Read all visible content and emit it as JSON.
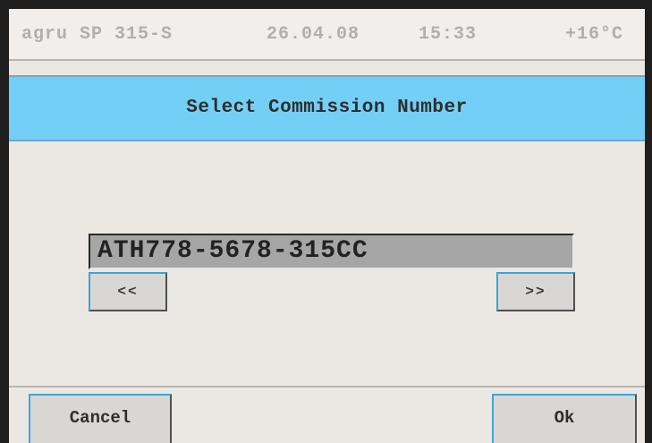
{
  "status_bar": {
    "device": "agru SP 315-S",
    "date": "26.04.08",
    "time": "15:33",
    "temperature": "+16°C"
  },
  "header": {
    "title": "Select Commission Number"
  },
  "commission": {
    "value": "ATH778-5678-315CC"
  },
  "navigation": {
    "prev_label": "<<",
    "next_label": ">>"
  },
  "actions": {
    "cancel_label": "Cancel",
    "ok_label": "Ok"
  },
  "colors": {
    "header_bg": "#73cff5",
    "screen_bg": "#ebe7e3",
    "field_bg": "#a6a6a6",
    "button_bg": "#d9d7d4",
    "button_highlight": "#3aa6d6"
  }
}
